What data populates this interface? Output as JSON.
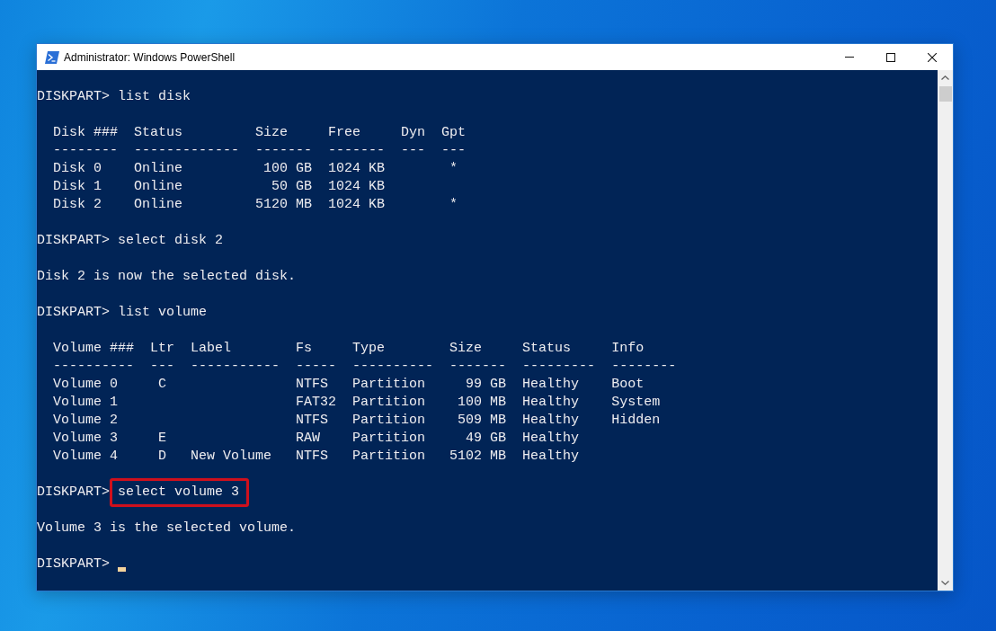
{
  "window": {
    "title": "Administrator: Windows PowerShell"
  },
  "console": {
    "blocks": [
      {
        "kind": "command",
        "prompt": "DISKPART>",
        "command": "list disk",
        "highlighted": false
      },
      {
        "kind": "table",
        "columns": [
          {
            "header": "Disk ###",
            "rule": "--------",
            "kind": "text"
          },
          {
            "header": "Status",
            "rule": "-------------",
            "kind": "text"
          },
          {
            "header": "Size",
            "rule": "-------",
            "kind": "number"
          },
          {
            "header": "Free",
            "rule": "-------",
            "kind": "number"
          },
          {
            "header": "Dyn",
            "rule": "---"
          },
          {
            "header": "Gpt",
            "rule": "---",
            "kind": "flag"
          }
        ],
        "rows": [
          [
            "Disk 0",
            "Online",
            "100 GB",
            "1024 KB",
            null,
            "*"
          ],
          [
            "Disk 1",
            "Online",
            "50 GB",
            "1024 KB",
            null,
            null
          ],
          [
            "Disk 2",
            "Online",
            "5120 MB",
            "1024 KB",
            null,
            "*"
          ]
        ]
      },
      {
        "kind": "command",
        "prompt": "DISKPART>",
        "command": "select disk 2",
        "highlighted": false
      },
      {
        "kind": "message",
        "text": "Disk 2 is now the selected disk."
      },
      {
        "kind": "command",
        "prompt": "DISKPART>",
        "command": "list volume",
        "highlighted": false
      },
      {
        "kind": "table",
        "columns": [
          {
            "header": "Volume ###",
            "rule": "----------",
            "kind": "text"
          },
          {
            "header": "Ltr",
            "rule": "---",
            "kind": "flag"
          },
          {
            "header": "Label",
            "rule": "-----------",
            "kind": "text"
          },
          {
            "header": "Fs",
            "rule": "-----",
            "kind": "text"
          },
          {
            "header": "Type",
            "rule": "----------",
            "kind": "text"
          },
          {
            "header": "Size",
            "rule": "-------",
            "kind": "number"
          },
          {
            "header": "Status",
            "rule": "---------",
            "kind": "text"
          },
          {
            "header": "Info",
            "rule": "--------",
            "kind": "text"
          }
        ],
        "rows": [
          [
            "Volume 0",
            "C",
            null,
            "NTFS",
            "Partition",
            "99 GB",
            "Healthy",
            "Boot"
          ],
          [
            "Volume 1",
            null,
            null,
            "FAT32",
            "Partition",
            "100 MB",
            "Healthy",
            "System"
          ],
          [
            "Volume 2",
            null,
            null,
            "NTFS",
            "Partition",
            "509 MB",
            "Healthy",
            "Hidden"
          ],
          [
            "Volume 3",
            "E",
            null,
            "RAW",
            "Partition",
            "49 GB",
            "Healthy",
            null
          ],
          [
            "Volume 4",
            "D",
            "New Volume",
            "NTFS",
            "Partition",
            "5102 MB",
            "Healthy",
            null
          ]
        ]
      },
      {
        "kind": "command",
        "prompt": "DISKPART>",
        "command": "select volume 3",
        "highlighted": true
      },
      {
        "kind": "message",
        "text": "Volume 3 is the selected volume."
      },
      {
        "kind": "prompt",
        "prompt": "DISKPART>",
        "cursor": true
      }
    ]
  }
}
